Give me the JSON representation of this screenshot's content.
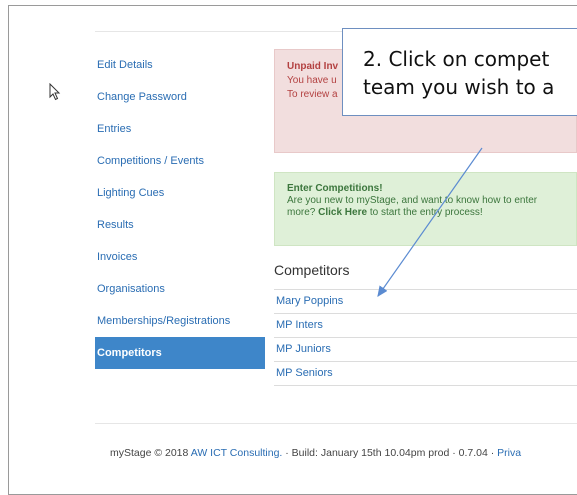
{
  "sidebar": {
    "items": [
      {
        "label": "Edit Details"
      },
      {
        "label": "Change Password"
      },
      {
        "label": "Entries"
      },
      {
        "label": "Competitions / Events"
      },
      {
        "label": "Lighting Cues"
      },
      {
        "label": "Results"
      },
      {
        "label": "Invoices"
      },
      {
        "label": "Organisations"
      },
      {
        "label": "Memberships/Registrations"
      },
      {
        "label": "Competitors"
      }
    ]
  },
  "alerts": {
    "unpaid": {
      "title": "Unpaid Inv",
      "line1": "You have u",
      "line2": "To review a"
    },
    "enter": {
      "title": "Enter Competitions!",
      "line1": "Are you new to myStage, and want to know how to enter",
      "line2_pre": "more? ",
      "line2_link": "Click Here",
      "line2_post": " to start the entry process!"
    }
  },
  "callout": {
    "line1": "2. Click on compet",
    "line2": "team you wish to a"
  },
  "competitors": {
    "title": "Competitors",
    "rows": [
      "Mary Poppins",
      "MP Inters",
      "MP Juniors",
      "MP Seniors"
    ]
  },
  "footer": {
    "prefix": "myStage © 2018 ",
    "company": "AW ICT Consulting.",
    "build": " · Build: January 15th 10.04pm prod · 0.7.04 · ",
    "privacy": "Priva"
  },
  "colors": {
    "accent": "#3e86c9",
    "link": "#2a6db3",
    "danger_bg": "#f2dede",
    "success_bg": "#dff0d8"
  }
}
